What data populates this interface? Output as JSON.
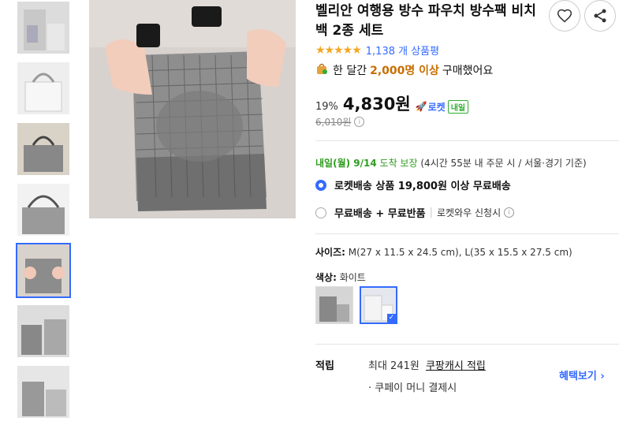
{
  "product": {
    "title": "벨리안 여행용 방수 파우치 방수팩 비치백 2종 세트",
    "rating": {
      "stars": "★★★★★",
      "value": 4.5,
      "count_text": "1,138 개 상품평"
    },
    "purchase": {
      "prefix": "한 달간",
      "highlight": "2,000명 이상",
      "suffix": "구매했어요"
    },
    "price": {
      "discount": "19%",
      "sale": "4,830원",
      "original": "6,010원",
      "rocket": "로켓",
      "rocket_badge": "내일"
    },
    "info_icon": "i",
    "delivery": {
      "date": "내일(월) 9/14",
      "guarantee": "도착 보장",
      "detail": "(4시간 55분 내 주문 시 / 서울⋅경기 기준)"
    },
    "options": [
      {
        "label": "로켓배송 상품 19,800원 이상 무료배송",
        "selected": true
      },
      {
        "label": "무료배송 + 무료반품",
        "extra": "로켓와우 신청시",
        "selected": false
      }
    ],
    "size": {
      "label": "사이즈:",
      "value": "M(27 x 11.5 x 24.5 cm), L(35 x 15.5 x 27.5 cm)"
    },
    "color": {
      "label": "색상:",
      "value": "화이트"
    },
    "points": {
      "label": "적립",
      "line1_prefix": "최대 241원",
      "line1_link": "쿠팡캐시 적립",
      "line2": "· 쿠페이 머니 결제시",
      "benefit": "혜택보기"
    }
  },
  "icons": {
    "wishlist": "heart-icon",
    "share": "share-icon"
  },
  "colors": {
    "accent": "#346aff",
    "star": "#f5a623",
    "green": "#2eae2e",
    "orange": "#c86e00"
  }
}
